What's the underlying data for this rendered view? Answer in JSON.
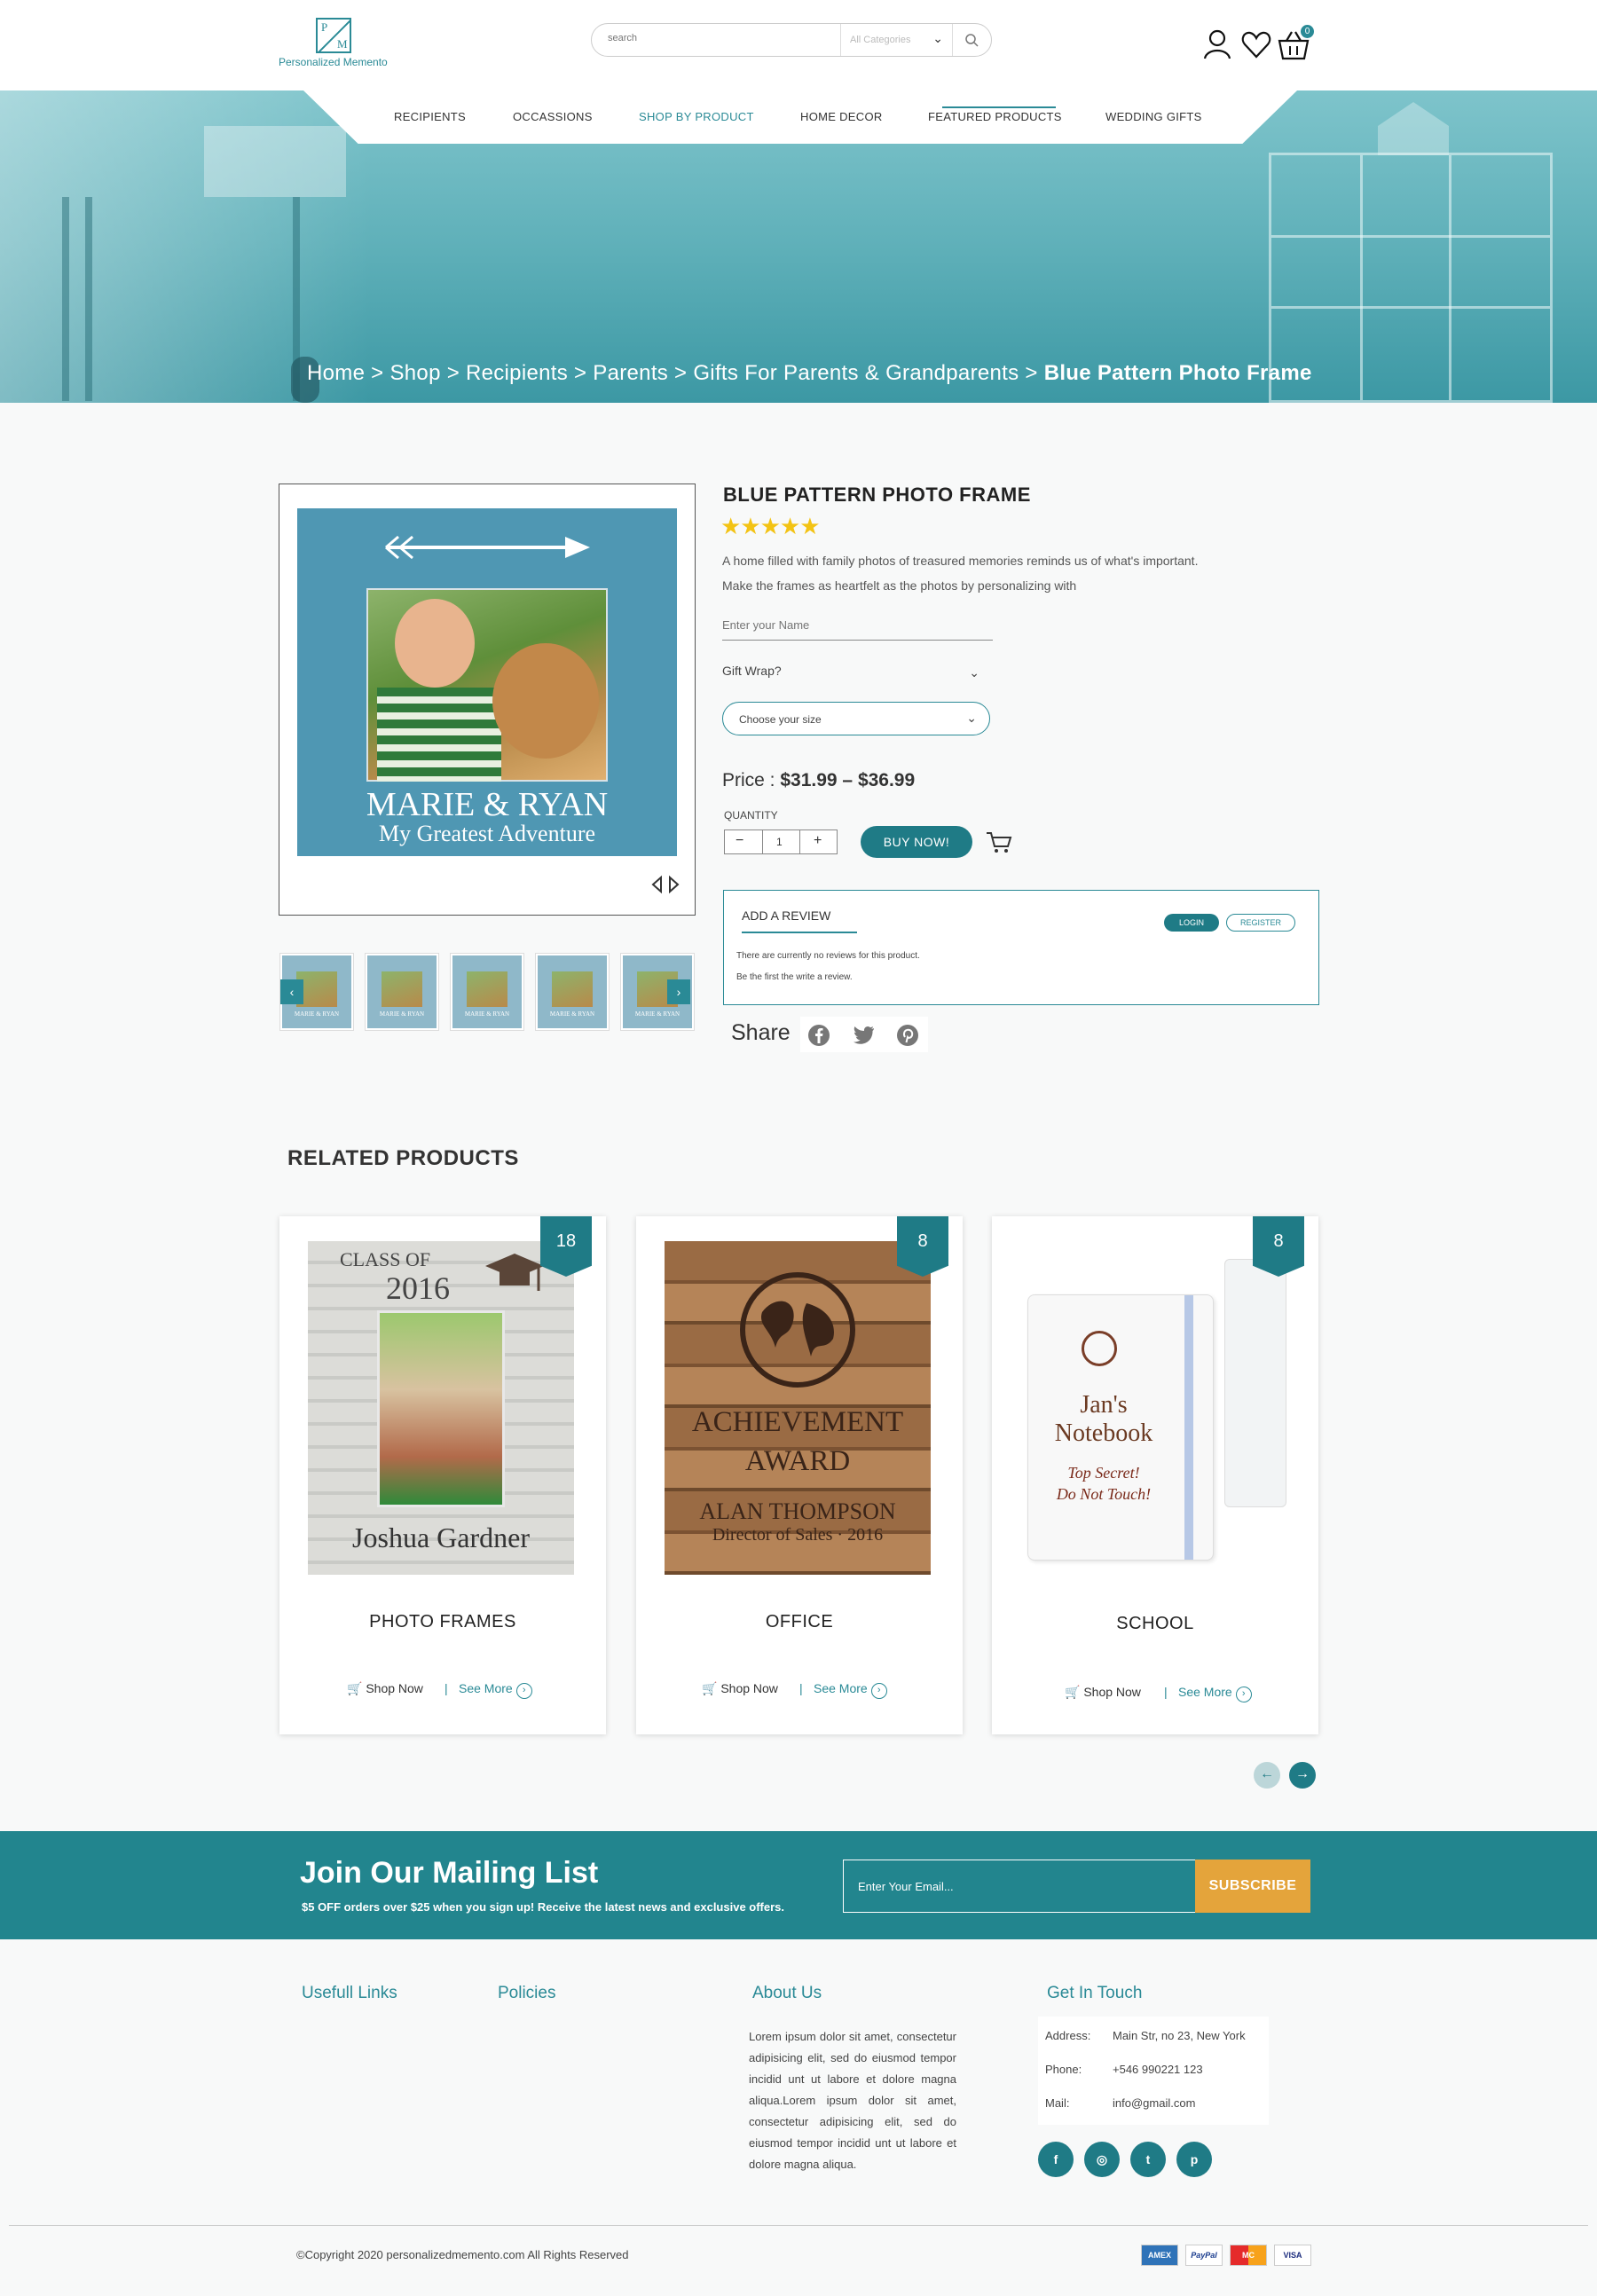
{
  "header": {
    "logo_text": "Personalized Memento",
    "logo_letters": [
      "P",
      "M"
    ],
    "search": {
      "placeholder": "search",
      "category": "All Categories"
    },
    "cart_count": "0",
    "icons": [
      "user-icon",
      "heart-icon",
      "basket-icon"
    ]
  },
  "nav": {
    "items": [
      "RECIPIENTS",
      "OCCASSIONS",
      "SHOP BY PRODUCT",
      "HOME DECOR",
      "FEATURED PRODUCTS",
      "WEDDING GIFTS"
    ],
    "active": "SHOP BY PRODUCT"
  },
  "breadcrumb": {
    "path": "Home > Shop > Recipients > Parents > Gifts For Parents & Grandparents > ",
    "current": "Blue Pattern Photo Frame"
  },
  "product": {
    "title": "BLUE PATTERN PHOTO FRAME",
    "stars": "★★★★★",
    "rating": 5,
    "description": "A home filled with family photos of treasured memories reminds us of what's important. Make the frames as heartfelt as the photos by personalizing with",
    "image_line1": "MARIE & RYAN",
    "image_line2": "My Greatest Adventure",
    "name_placeholder": "Enter your Name",
    "gift_wrap_label": "Gift Wrap?",
    "size_select": "Choose your size",
    "price_label": "Price : ",
    "price_value": "$31.99 – $36.99",
    "quantity_label": "QUANTITY",
    "quantity": "1",
    "qty_minus": "−",
    "qty_plus": "+",
    "buy_label": "BUY NOW!",
    "thumbnail_title": "MARIE & RYAN",
    "thumbnail_sub": "My Greatest Adventure"
  },
  "review": {
    "title": "ADD A REVIEW",
    "login": "LOGIN",
    "register": "REGISTER",
    "line1": "There are currently no reviews for this product.",
    "line2": "Be the first the write a review."
  },
  "share": {
    "label": "Share",
    "networks": [
      "facebook-icon",
      "twitter-icon",
      "pinterest-icon"
    ]
  },
  "related": {
    "heading": "RELATED PRODUCTS",
    "shop_now": "Shop Now",
    "separator": "|",
    "see_more": "See More",
    "cards": [
      {
        "badge": "18",
        "title": "PHOTO FRAMES",
        "img_top": "CLASS OF",
        "img_year": "2016",
        "img_name": "Joshua Gardner"
      },
      {
        "badge": "8",
        "title": "OFFICE",
        "img_top": "ACHIEVEMENT",
        "img_year": "AWARD",
        "img_name": "ALAN THOMPSON",
        "img_sub": "Director of Sales · 2016"
      },
      {
        "badge": "8",
        "title": "SCHOOL",
        "img_top": "Jan's",
        "img_year": "Notebook",
        "img_name": "Top Secret!",
        "img_sub": "Do Not Touch!"
      }
    ]
  },
  "mailing": {
    "title": "Join Our Mailing List",
    "subtitle": "$5 OFF orders over $25 when you sign up! Receive the latest news and exclusive offers.",
    "placeholder": "Enter Your Email...",
    "button": "SUBSCRIBE"
  },
  "footer": {
    "useful_links": "Usefull Links",
    "policies": "Policies",
    "about_title": "About Us",
    "about_text": "Lorem ipsum dolor sit amet, consectetur adipisicing elit, sed do eiusmod tempor incidid unt ut labore et dolore magna aliqua.Lorem ipsum dolor sit amet, consectetur adipisicing elit, sed do eiusmod tempor incidid unt ut labore et dolore magna aliqua.",
    "contact_title": "Get In Touch",
    "address_label": "Address:",
    "address": "Main Str, no 23, New York",
    "phone_label": "Phone:",
    "phone": "+546 990221 123",
    "mail_label": "Mail:",
    "mail": "info@gmail.com",
    "social": [
      "f",
      "◎",
      "t",
      "p"
    ],
    "copyright": "©Copyright 2020 personalizedmemento.com All Rights Reserved",
    "payments": [
      "AMEX",
      "PayPal",
      "MC",
      "VISA"
    ]
  },
  "colors": {
    "teal": "#22858e",
    "accent": "#2a8a96",
    "star": "#f3c314",
    "subscribe": "#e4a43b"
  }
}
